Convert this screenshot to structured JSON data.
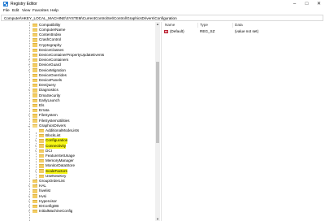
{
  "window": {
    "title": "Registry Editor"
  },
  "menu": [
    "File",
    "Edit",
    "View",
    "Favorites",
    "Help"
  ],
  "address": "Computer\\HKEY_LOCAL_MACHINE\\SYSTEM\\CurrentControlSet\\Control\\GraphicsDrivers\\Configuration",
  "tree": {
    "top_items": [
      "Compatibility",
      "ComputerName",
      "ContentIndex",
      "CrashControl",
      "Cryptography",
      "DeviceClasses",
      "DeviceContainerPropertyUpdateEvents",
      "DeviceContainers",
      "DeviceGuard",
      "DeviceMigration",
      "DeviceOverrides",
      "DevicePanels",
      "DevQuery",
      "Diagnostics",
      "DmaSecurity",
      "EarlyLaunch",
      "Els",
      "Errata",
      "FileSystem",
      "FileSystemUtilities",
      "GraphicsDrivers"
    ],
    "child_items": [
      "AdditionalModeLists",
      "BlockList",
      "Configuration",
      "Connectivity",
      "DCI",
      "FeatureSetUsage",
      "MemoryManager",
      "MonitorDataStore",
      "ScaleFactors",
      "UseNewKey"
    ],
    "bottom_items": [
      "GroupOrderList",
      "HAL",
      "hivelist",
      "Hvsi",
      "Hypervisor",
      "IDConfigDB",
      "InitialMachineConfig"
    ]
  },
  "values_pane": {
    "columns": [
      "Name",
      "Type",
      "Data"
    ],
    "rows": [
      {
        "name": "(Default)",
        "type": "REG_SZ",
        "data": "(value not set)"
      }
    ]
  },
  "colors": {
    "highlight": "#f7f716",
    "folder": "#f3cd63"
  },
  "icons": {
    "app": "registry-icon",
    "folder": "folder-icon",
    "value": "string-value-icon"
  }
}
